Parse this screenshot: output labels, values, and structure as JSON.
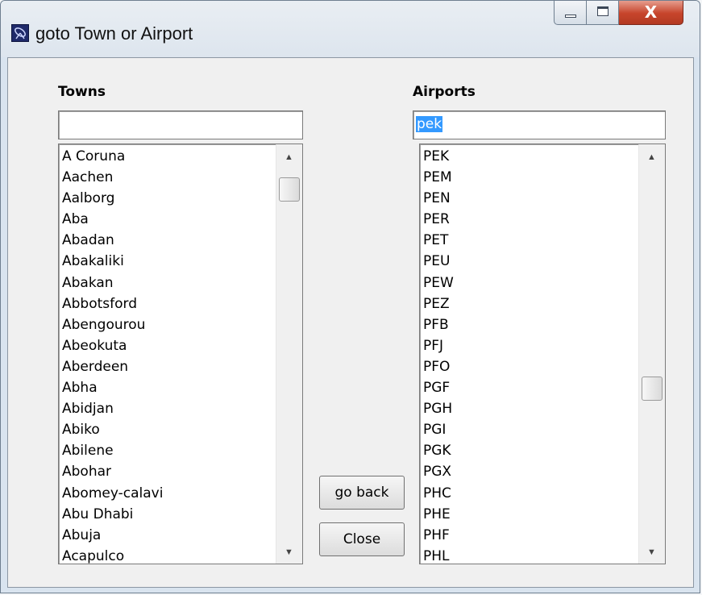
{
  "window": {
    "title": "goto Town or Airport",
    "close_glyph": "X",
    "icons": {
      "app": "radar-dish-icon",
      "minimize": "minimize-icon",
      "maximize": "maximize-icon",
      "close": "close-icon"
    }
  },
  "towns": {
    "label": "Towns",
    "search_value": "",
    "items": [
      "A Coruna",
      "Aachen",
      "Aalborg",
      "Aba",
      "Abadan",
      "Abakaliki",
      "Abakan",
      "Abbotsford",
      "Abengourou",
      "Abeokuta",
      "Aberdeen",
      "Abha",
      "Abidjan",
      "Abiko",
      "Abilene",
      "Abohar",
      "Abomey-calavi",
      "Abu Dhabi",
      "Abuja",
      "Acapulco"
    ],
    "scroll_position": 0.03
  },
  "airports": {
    "label": "Airports",
    "search_value": "pek",
    "items": [
      "PEK",
      "PEM",
      "PEN",
      "PER",
      "PET",
      "PEU",
      "PEW",
      "PEZ",
      "PFB",
      "PFJ",
      "PFO",
      "PGF",
      "PGH",
      "PGI",
      "PGK",
      "PGX",
      "PHC",
      "PHE",
      "PHF",
      "PHL"
    ],
    "scroll_position": 0.6
  },
  "buttons": {
    "go_back": "go back",
    "close": "Close"
  }
}
